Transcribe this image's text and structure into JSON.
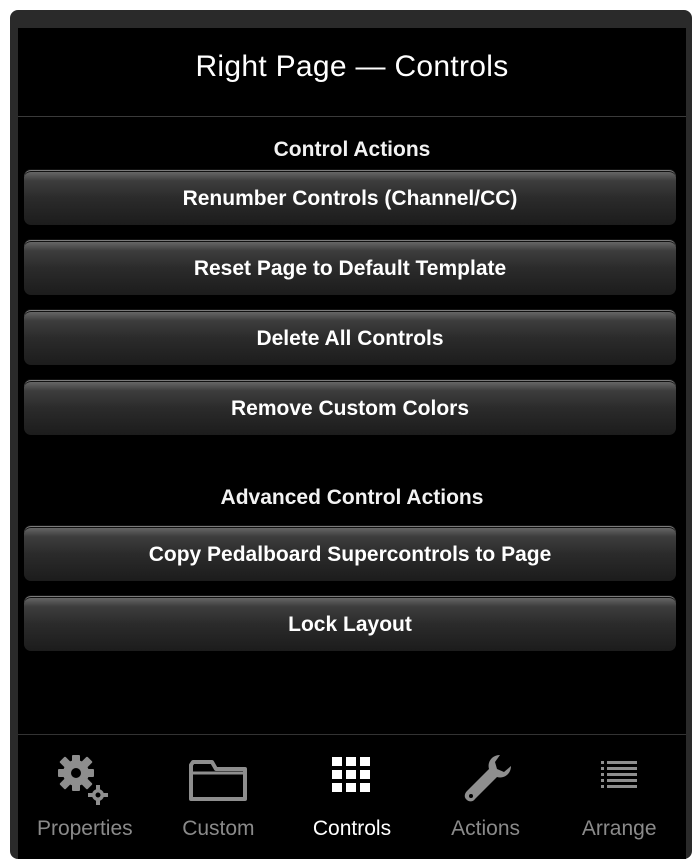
{
  "header": {
    "title": "Right Page — Controls"
  },
  "sections": [
    {
      "heading": "Control Actions",
      "buttons": [
        "Renumber Controls (Channel/CC)",
        "Reset Page to Default Template",
        "Delete All Controls",
        "Remove Custom Colors"
      ]
    },
    {
      "heading": "Advanced Control Actions",
      "buttons": [
        "Copy Pedalboard Supercontrols to Page",
        "Lock Layout"
      ]
    }
  ],
  "tabbar": {
    "active": "Controls",
    "tabs": [
      {
        "label": "Properties",
        "icon": "gears-icon"
      },
      {
        "label": "Custom",
        "icon": "folder-icon"
      },
      {
        "label": "Controls",
        "icon": "grid-icon"
      },
      {
        "label": "Actions",
        "icon": "wrench-icon"
      },
      {
        "label": "Arrange",
        "icon": "list-icon"
      }
    ]
  },
  "colors": {
    "background": "#000000",
    "panel": "#2a2a2a",
    "text": "#ffffff",
    "inactive_tab": "#8a8a8a"
  }
}
